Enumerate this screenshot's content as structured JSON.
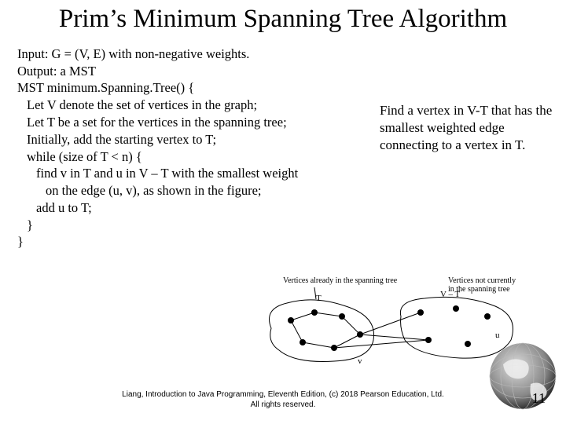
{
  "title": "Prim’s Minimum Spanning Tree Algorithm",
  "pseudo": {
    "l1": "Input: G = (V, E) with non-negative weights.",
    "l2": "Output: a MST",
    "l3": "MST minimum.Spanning.Tree() {",
    "l4": "Let V denote the set of vertices in the graph;",
    "l5": "Let T be a set for the vertices in the spanning tree;",
    "l6": "Initially, add the starting vertex to T;",
    "l7": "while (size of T < n) {",
    "l8": "find v in T and u in V – T with the smallest weight",
    "l9": "on the edge (u, v), as shown in the figure;",
    "l10": "add u to T;",
    "l11": "}",
    "l12": "}"
  },
  "note": "Find a vertex in V-T that has the smallest weighted edge connecting to a vertex in T.",
  "figure": {
    "label_left": "Vertices already in the spanning tree",
    "label_right": "Vertices not currently in the spanning tree",
    "T": "T",
    "VT": "V – T",
    "v": "v",
    "u": "u"
  },
  "footer": {
    "line1": "Liang, Introduction to Java Programming, Eleventh Edition, (c) 2018 Pearson Education, Ltd.",
    "line2": "All rights reserved."
  },
  "page": "11"
}
